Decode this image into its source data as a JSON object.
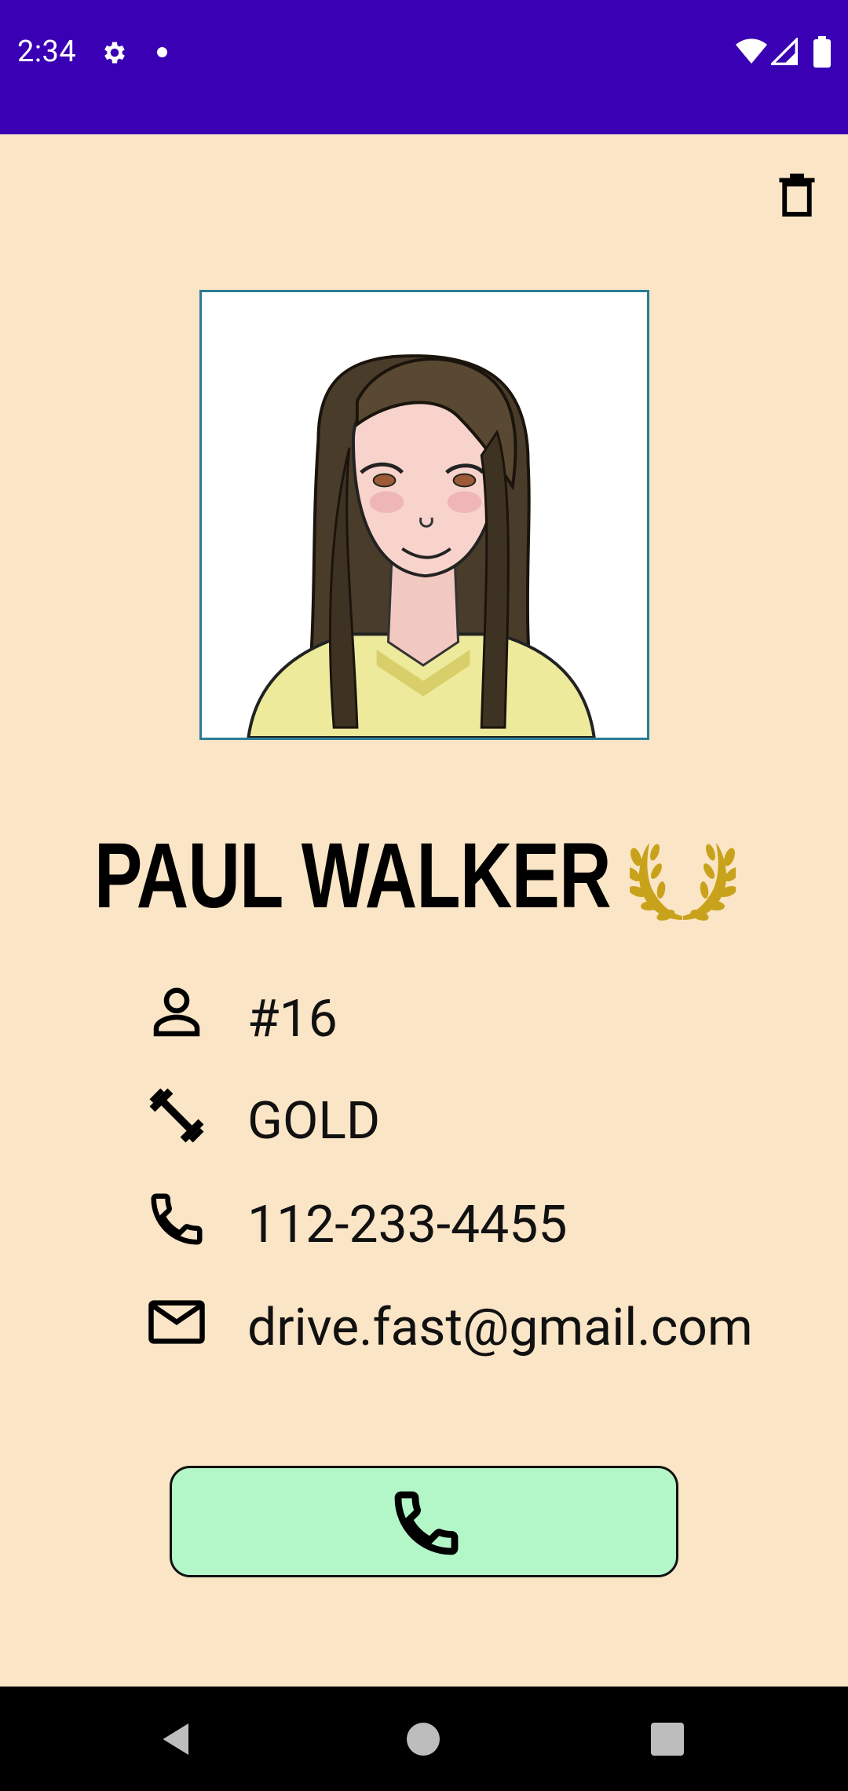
{
  "status_bar": {
    "time": "2:34",
    "icons": [
      "gear-icon",
      "notification-dot",
      "wifi-icon",
      "signal-icon",
      "battery-icon"
    ],
    "background": "#3A00B3"
  },
  "toolbar": {
    "delete_icon": "trash-icon"
  },
  "profile": {
    "name": "PAUL WALKER",
    "badge_icon": "laurel-wreath-icon",
    "badge_color": "#C9A21C",
    "photo_icon": "profile-portrait"
  },
  "details": [
    {
      "icon": "person-icon",
      "value": "#16"
    },
    {
      "icon": "dumbbell-icon",
      "value": "GOLD"
    },
    {
      "icon": "phone-icon",
      "value": "112-233-4455"
    },
    {
      "icon": "mail-icon",
      "value": "drive.fast@gmail.com"
    }
  ],
  "call_button": {
    "icon": "phone-icon",
    "background": "#B3F6C8"
  },
  "nav_bar": {
    "icons": [
      "back-icon",
      "home-icon",
      "recents-icon"
    ]
  },
  "colors": {
    "content_background": "#FAE5C6",
    "photo_border": "#2B7C95"
  }
}
